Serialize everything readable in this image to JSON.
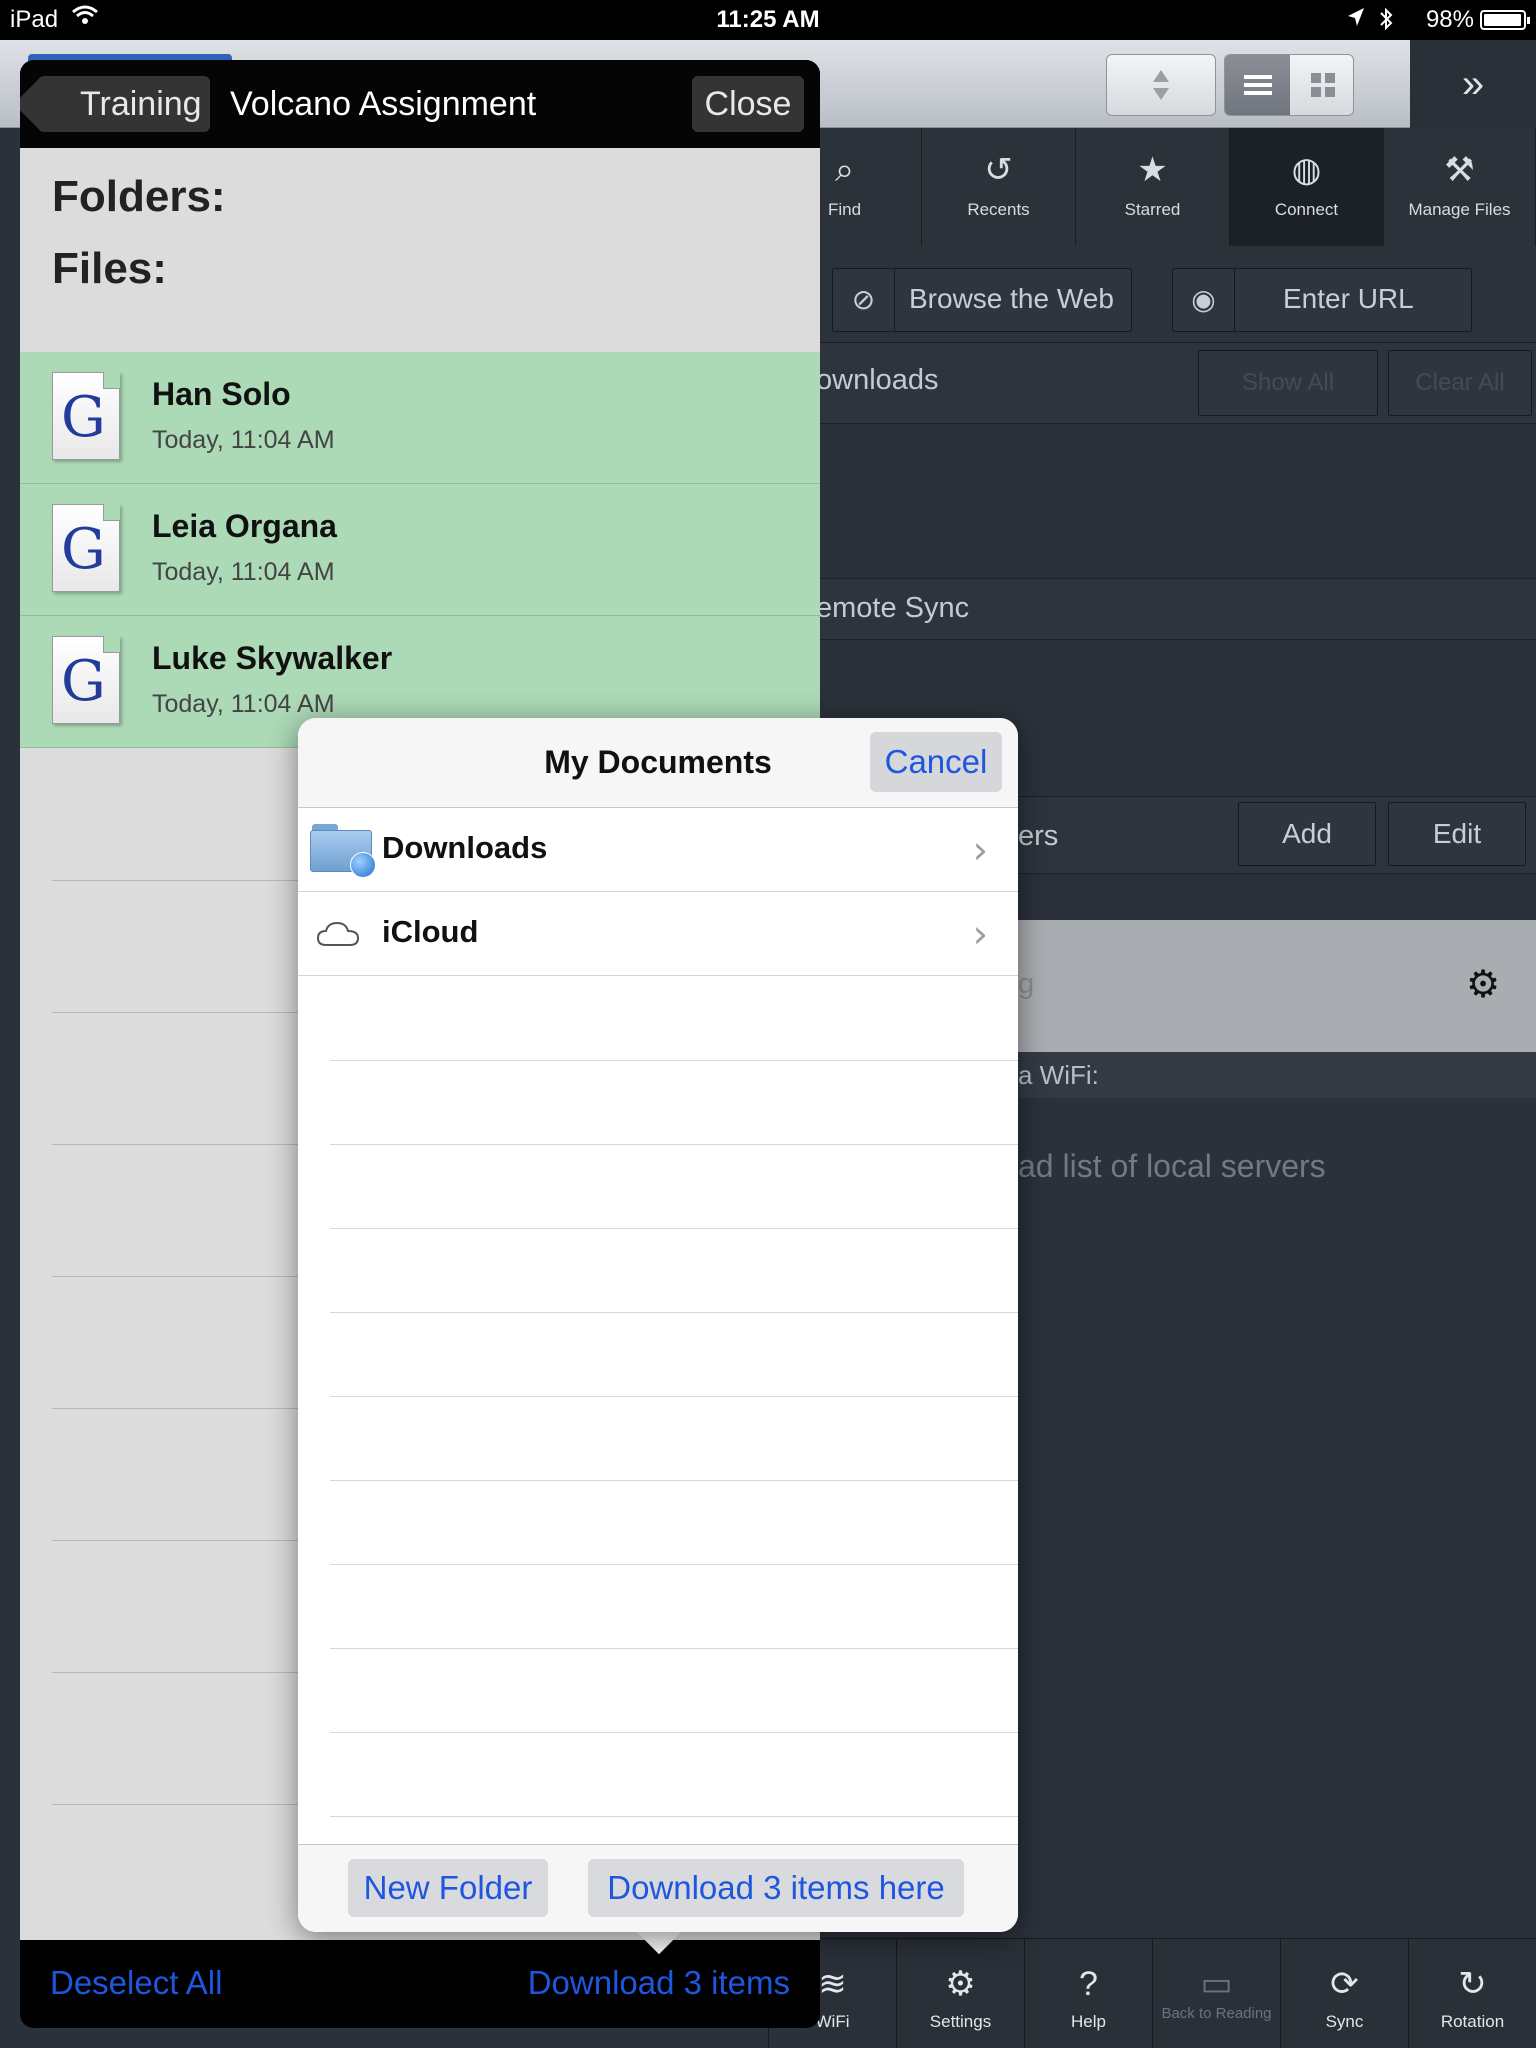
{
  "status_bar": {
    "device": "iPad",
    "time": "11:25 AM",
    "battery": "98%",
    "battery_level": 0.98
  },
  "background_app": {
    "nav_tabs": [
      {
        "label": "Find",
        "icon": "magnifier-icon"
      },
      {
        "label": "Recents",
        "icon": "clock-icon"
      },
      {
        "label": "Starred",
        "icon": "star-icon"
      },
      {
        "label": "Connect",
        "icon": "globe-icon"
      },
      {
        "label": "Manage Files",
        "icon": "tools-icon"
      }
    ],
    "browse_web": "Browse the Web",
    "enter_url": "Enter URL",
    "downloads_header": "ownloads",
    "show_all": "Show All",
    "clear_all": "Clear All",
    "remote_sync_header": "emote Sync",
    "servers_header": "ers",
    "add": "Add",
    "edit": "Edit",
    "grey_row_text": "g",
    "wifi_header": "a WiFi:",
    "local_servers_text": "ad list of local servers",
    "bottom_tabs": [
      {
        "label": "WiFi",
        "icon": "wifi-icon"
      },
      {
        "label": "Settings",
        "icon": "gear-icon"
      },
      {
        "label": "Help",
        "icon": "question-icon"
      },
      {
        "label": "Back to Reading",
        "icon": "book-icon"
      },
      {
        "label": "Sync",
        "icon": "sync-icon"
      },
      {
        "label": "Rotation",
        "icon": "rotation-icon"
      }
    ]
  },
  "left_panel": {
    "back_label": "Training",
    "title": "Volcano Assignment",
    "close_label": "Close",
    "folders_label": "Folders:",
    "files_label": "Files:",
    "files": [
      {
        "name": "Han Solo",
        "date": "Today, 11:04 AM"
      },
      {
        "name": "Leia Organa",
        "date": "Today, 11:04 AM"
      },
      {
        "name": "Luke Skywalker",
        "date": "Today, 11:04 AM"
      }
    ],
    "file_icon_letter": "G",
    "deselect_all": "Deselect All",
    "download_items": "Download 3 items"
  },
  "modal": {
    "title": "My Documents",
    "cancel": "Cancel",
    "rows": [
      {
        "label": "Downloads",
        "icon": "downloads-folder-icon"
      },
      {
        "label": "iCloud",
        "icon": "cloud-icon"
      }
    ],
    "new_folder": "New Folder",
    "download_here": "Download 3 items here"
  },
  "colors": {
    "link_blue": "#1f56e0",
    "selected_row": "#acd9b6"
  }
}
